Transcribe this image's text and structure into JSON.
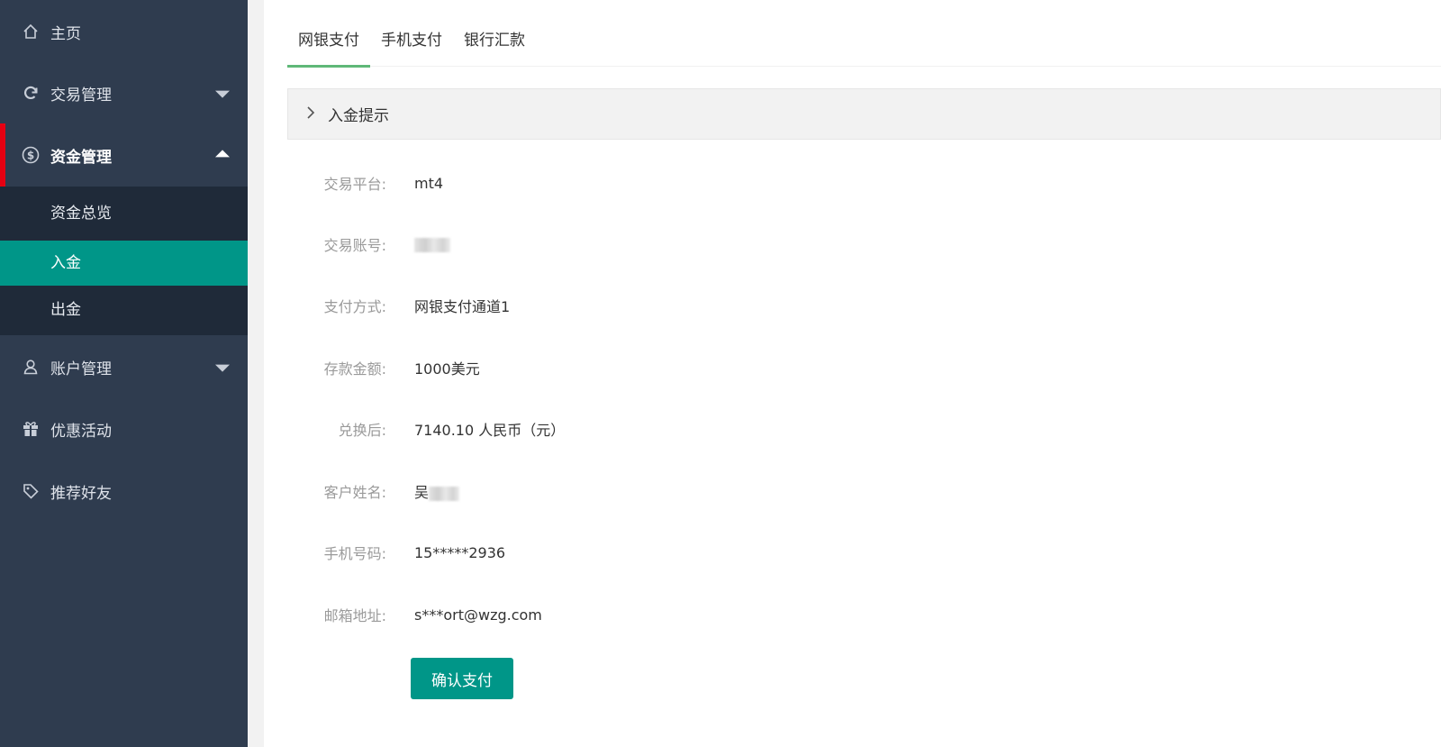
{
  "sidebar": {
    "items": [
      {
        "label": "主页",
        "icon": "home-icon"
      },
      {
        "label": "交易管理",
        "icon": "refresh-icon"
      },
      {
        "label": "资金管理",
        "icon": "dollar-icon"
      },
      {
        "label": "账户管理",
        "icon": "user-icon"
      },
      {
        "label": "优惠活动",
        "icon": "gift-icon"
      },
      {
        "label": "推荐好友",
        "icon": "tag-icon"
      }
    ],
    "submenu": [
      {
        "label": "资金总览"
      },
      {
        "label": "入金"
      },
      {
        "label": "出金"
      }
    ]
  },
  "tabs": [
    {
      "label": "网银支付"
    },
    {
      "label": "手机支付"
    },
    {
      "label": "银行汇款"
    }
  ],
  "collapse": {
    "title": "入金提示"
  },
  "form": {
    "platform": {
      "label": "交易平台:",
      "value": "mt4"
    },
    "account": {
      "label": "交易账号:"
    },
    "method": {
      "label": "支付方式:",
      "value": "网银支付通道1"
    },
    "amount": {
      "label": "存款金额:",
      "value": "1000美元"
    },
    "converted": {
      "label": "兑换后:",
      "value": "7140.10 人民币（元）"
    },
    "name": {
      "label": "客户姓名:",
      "value": "吴"
    },
    "phone": {
      "label": "手机号码:",
      "value": "15*****2936"
    },
    "email": {
      "label": "邮箱地址:",
      "value": "s***ort@wzg.com"
    }
  },
  "confirm_button": "确认支付",
  "colors": {
    "sidebar_bg": "#2f3c4f",
    "submenu_bg": "#1f2a39",
    "accent_teal": "#009688",
    "active_marker": "#e60012",
    "tab_underline": "#5fb878"
  }
}
